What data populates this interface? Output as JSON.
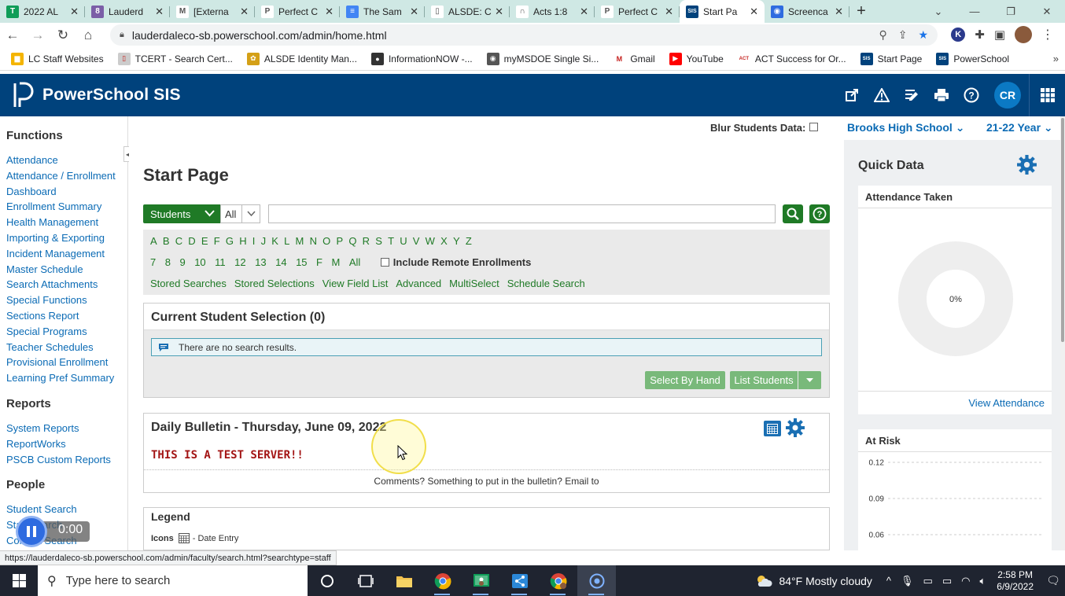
{
  "browser": {
    "tabs": [
      {
        "title": "2022 AL",
        "fav_color": "#0f9d58",
        "fav_text": "T"
      },
      {
        "title": "Lauderd",
        "fav_color": "#7b5ea7",
        "fav_text": "8"
      },
      {
        "title": "[Externa",
        "fav_color": "#ffffff",
        "fav_text": "M"
      },
      {
        "title": "Perfect C",
        "fav_color": "#ffffff",
        "fav_text": "P"
      },
      {
        "title": "The Sam",
        "fav_color": "#4285f4",
        "fav_text": "≡"
      },
      {
        "title": "ALSDE: C",
        "fav_color": "#ffffff",
        "fav_text": "▯"
      },
      {
        "title": "Acts 1:8",
        "fav_color": "#ffffff",
        "fav_text": "∩"
      },
      {
        "title": "Perfect C",
        "fav_color": "#ffffff",
        "fav_text": "P"
      },
      {
        "title": "Start Pa",
        "fav_color": "#00427c",
        "fav_text": "SIS",
        "active": true
      },
      {
        "title": "Screenca",
        "fav_color": "#2e6be0",
        "fav_text": "◉"
      }
    ],
    "url": "lauderdaleco-sb.powerschool.com/admin/home.html",
    "bookmarks": [
      {
        "label": "LC Staff Websites",
        "icon_color": "#f4b400",
        "icon_text": "▆"
      },
      {
        "label": "TCERT - Search Cert...",
        "icon_color": "#cccccc",
        "icon_text": "▯"
      },
      {
        "label": "ALSDE Identity Man...",
        "icon_color": "#d4a017",
        "icon_text": "✿"
      },
      {
        "label": "InformationNOW -...",
        "icon_color": "#333333",
        "icon_text": "●"
      },
      {
        "label": "myMSDOE Single Si...",
        "icon_color": "#555555",
        "icon_text": "◉"
      },
      {
        "label": "Gmail",
        "icon_color": "#ffffff",
        "icon_text": "M"
      },
      {
        "label": "YouTube",
        "icon_color": "#ff0000",
        "icon_text": "▶"
      },
      {
        "label": "ACT Success for Or...",
        "icon_color": "#ffffff",
        "icon_text": "ACT"
      },
      {
        "label": "Start Page",
        "icon_color": "#00427c",
        "icon_text": "SIS"
      },
      {
        "label": "PowerSchool",
        "icon_color": "#00427c",
        "icon_text": "SIS"
      }
    ]
  },
  "header": {
    "brand": "PowerSchool SIS",
    "avatar_initials": "CR"
  },
  "nav": {
    "functions_title": "Functions",
    "functions": [
      "Attendance",
      "Attendance / Enrollment",
      "Dashboard",
      "Enrollment Summary",
      "Health Management",
      "Importing & Exporting",
      "Incident Management",
      "Master Schedule",
      "Search Attachments",
      "Special Functions",
      "Sections Report",
      "Special Programs",
      "Teacher Schedules",
      "Provisional Enrollment",
      "Learning Pref Summary"
    ],
    "reports_title": "Reports",
    "reports": [
      "System Reports",
      "ReportWorks",
      "PSCB Custom Reports"
    ],
    "people_title": "People",
    "people": [
      "Student Search",
      "Staff Search",
      "Contact Search"
    ]
  },
  "infobar": {
    "blur_label": "Blur Students Data:",
    "school": "Brooks High School",
    "year": "21-22 Year"
  },
  "main": {
    "title": "Start Page",
    "search": {
      "type_label": "Students",
      "scope_label": "All",
      "query": ""
    },
    "letters": [
      "A",
      "B",
      "C",
      "D",
      "E",
      "F",
      "G",
      "H",
      "I",
      "J",
      "K",
      "L",
      "M",
      "N",
      "O",
      "P",
      "Q",
      "R",
      "S",
      "T",
      "U",
      "V",
      "W",
      "X",
      "Y",
      "Z"
    ],
    "grades": [
      "7",
      "8",
      "9",
      "10",
      "11",
      "12",
      "13",
      "14",
      "15",
      "F",
      "M",
      "All"
    ],
    "remote_label": "Include Remote Enrollments",
    "search_links": [
      "Stored Searches",
      "Stored Selections",
      "View Field List",
      "Advanced",
      "MultiSelect",
      "Schedule Search"
    ],
    "selection": {
      "title": "Current Student Selection (0)",
      "empty_message": "There are no search results.",
      "select_by_hand": "Select By Hand",
      "list_students": "List Students"
    },
    "bulletin": {
      "title": "Daily Bulletin - Thursday, June 09, 2022",
      "test_notice": "THIS IS A TEST SERVER!!",
      "footer": "Comments? Something to put in the bulletin? Email to"
    },
    "legend": {
      "title": "Legend",
      "icons_label": "Icons",
      "date_entry": "- Date Entry"
    }
  },
  "quick_data": {
    "title": "Quick Data",
    "attendance_title": "Attendance Taken",
    "attendance_percent": "0%",
    "attendance_fraction": 0,
    "view_attendance": "View Attendance",
    "at_risk_title": "At Risk"
  },
  "chart_data": {
    "type": "line",
    "title": "At Risk",
    "y_ticks": [
      "0.12",
      "0.09",
      "0.06"
    ],
    "ylim": [
      0.06,
      0.12
    ],
    "series": []
  },
  "status_url": "https://lauderdaleco-sb.powerschool.com/admin/faculty/search.html?searchtype=staff",
  "recorder": {
    "time": "0:00"
  },
  "taskbar": {
    "search_placeholder": "Type here to search",
    "weather": "84°F  Mostly cloudy",
    "time": "2:58 PM",
    "date": "6/9/2022"
  },
  "colors": {
    "ps_blue": "#00427c",
    "ps_green": "#1f7a26",
    "link_blue": "#0b6bb5",
    "test_red": "#a31515"
  }
}
